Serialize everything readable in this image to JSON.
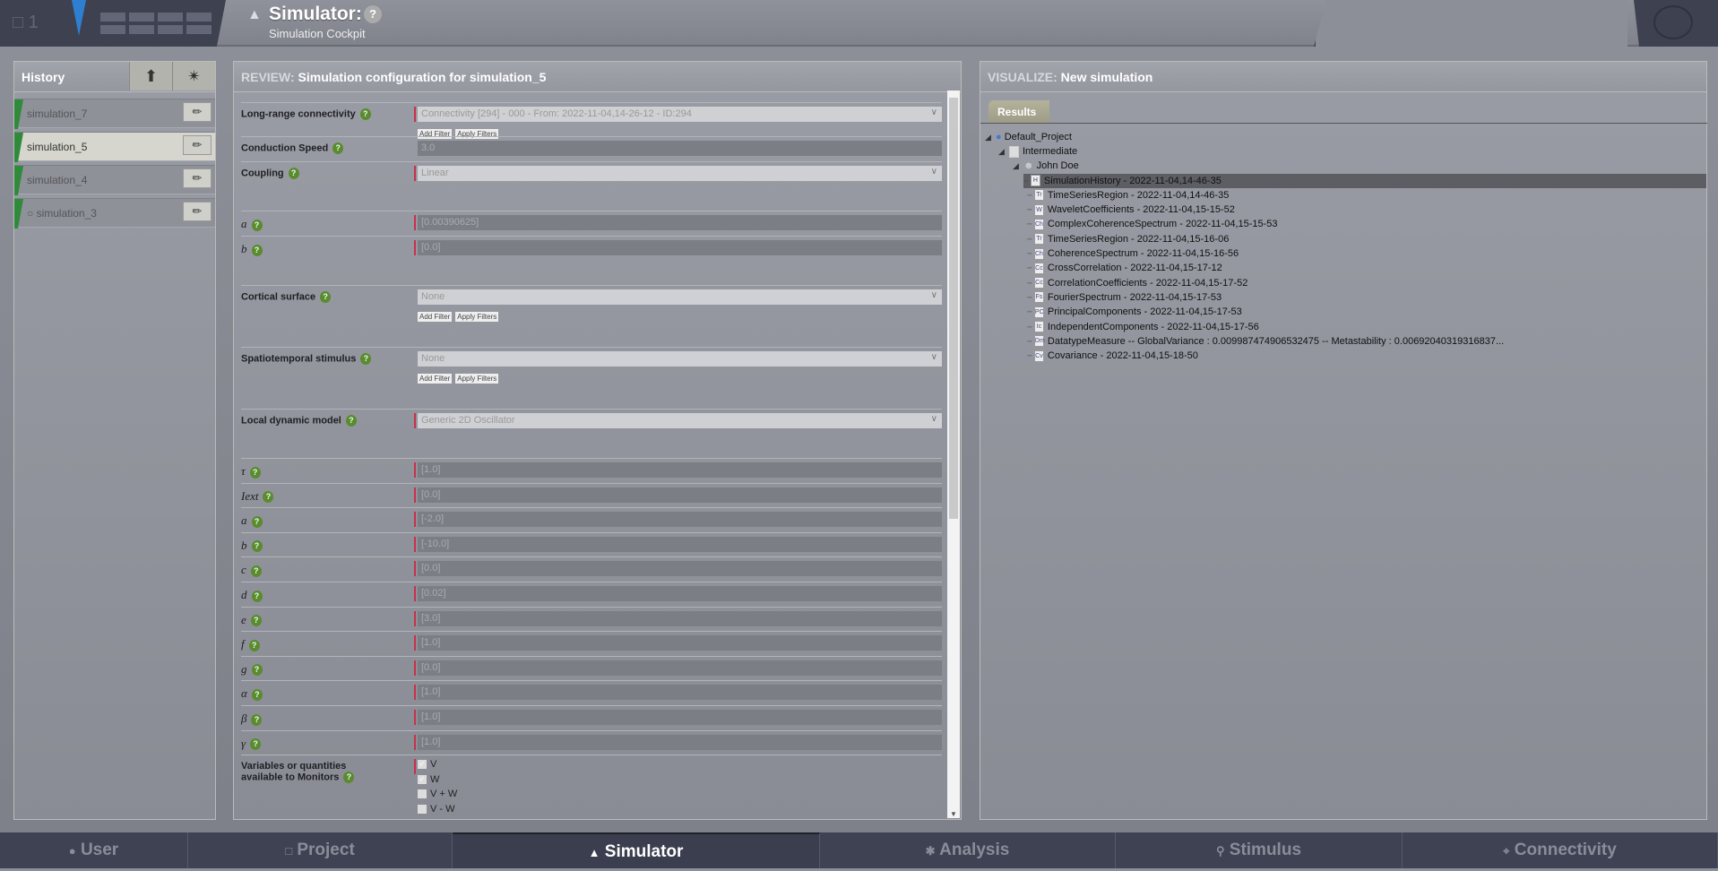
{
  "header": {
    "project_count": "1",
    "title": "Simulator:",
    "subtitle": "Simulation Cockpit",
    "help": "?"
  },
  "history": {
    "title": "History",
    "items": [
      {
        "label": "simulation_7",
        "selected": false
      },
      {
        "label": "simulation_5",
        "selected": true
      },
      {
        "label": "simulation_4",
        "selected": false
      },
      {
        "label": "○ simulation_3",
        "selected": false
      }
    ]
  },
  "review": {
    "prefix": "REVIEW:",
    "title": "Simulation configuration for simulation_5",
    "add_filter": "Add Filter",
    "apply_filters": "Apply Filters",
    "connectivity": {
      "label": "Long-range connectivity",
      "value": "Connectivity [294] - 000 - From: 2022-11-04,14-26-12 - ID:294"
    },
    "conduction": {
      "label": "Conduction Speed",
      "value": "3.0"
    },
    "coupling": {
      "label": "Coupling",
      "value": "Linear"
    },
    "coupling_params": [
      {
        "label": "a",
        "value": "[0.00390625]"
      },
      {
        "label": "b",
        "value": "[0.0]"
      }
    ],
    "cortical": {
      "label": "Cortical surface",
      "value": "None"
    },
    "stimulus": {
      "label": "Spatiotemporal stimulus",
      "value": "None"
    },
    "model": {
      "label": "Local dynamic model",
      "value": "Generic 2D Oscillator"
    },
    "model_params": [
      {
        "label": "τ",
        "value": "[1.0]"
      },
      {
        "label": "Iext",
        "value": "[0.0]"
      },
      {
        "label": "a",
        "value": "[-2.0]"
      },
      {
        "label": "b",
        "value": "[-10.0]"
      },
      {
        "label": "c",
        "value": "[0.0]"
      },
      {
        "label": "d",
        "value": "[0.02]"
      },
      {
        "label": "e",
        "value": "[3.0]"
      },
      {
        "label": "f",
        "value": "[1.0]"
      },
      {
        "label": "g",
        "value": "[0.0]"
      },
      {
        "label": "α",
        "value": "[1.0]"
      },
      {
        "label": "β",
        "value": "[1.0]"
      },
      {
        "label": "γ",
        "value": "[1.0]"
      }
    ],
    "variables": {
      "label_1": "Variables or quantities",
      "label_2": "available to Monitors",
      "options": [
        {
          "label": "V",
          "checked": true
        },
        {
          "label": "W",
          "checked": true
        },
        {
          "label": "V + W",
          "checked": false
        },
        {
          "label": "V - W",
          "checked": false
        }
      ]
    }
  },
  "visualize": {
    "prefix": "VISUALIZE:",
    "title": "New simulation",
    "tab": "Results",
    "tree": {
      "project": "Default_Project",
      "folder": "Intermediate",
      "user": "John Doe",
      "items": [
        {
          "icon": "H",
          "label": "SimulationHistory - 2022-11-04,14-46-35",
          "selected": true
        },
        {
          "icon": "Tr",
          "label": "TimeSeriesRegion - 2022-11-04,14-46-35"
        },
        {
          "icon": "W",
          "label": "WaveletCoefficients - 2022-11-04,15-15-52"
        },
        {
          "icon": "Ch",
          "label": "ComplexCoherenceSpectrum - 2022-11-04,15-15-53"
        },
        {
          "icon": "Tr",
          "label": "TimeSeriesRegion - 2022-11-04,15-16-06"
        },
        {
          "icon": "Ch",
          "label": "CoherenceSpectrum - 2022-11-04,15-16-56"
        },
        {
          "icon": "Cc",
          "label": "CrossCorrelation - 2022-11-04,15-17-12"
        },
        {
          "icon": "Cc",
          "label": "CorrelationCoefficients - 2022-11-04,15-17-52"
        },
        {
          "icon": "Fs",
          "label": "FourierSpectrum - 2022-11-04,15-17-53"
        },
        {
          "icon": "PC",
          "label": "PrincipalComponents - 2022-11-04,15-17-53"
        },
        {
          "icon": "Ic",
          "label": "IndependentComponents - 2022-11-04,15-17-56"
        },
        {
          "icon": "Dm",
          "label": "DatatypeMeasure -- GlobalVariance : 0.009987474906532475 -- Metastability : 0.00692040319316837..."
        },
        {
          "icon": "Cv",
          "label": "Covariance - 2022-11-04,15-18-50"
        }
      ]
    }
  },
  "footer": {
    "tabs": [
      {
        "label": "User",
        "icon": "user-icon"
      },
      {
        "label": "Project",
        "icon": "file-icon"
      },
      {
        "label": "Simulator",
        "icon": "rocket-icon",
        "active": true
      },
      {
        "label": "Analysis",
        "icon": "gear-icon"
      },
      {
        "label": "Stimulus",
        "icon": "pin-icon"
      },
      {
        "label": "Connectivity",
        "icon": "network-icon"
      }
    ]
  },
  "colors": {
    "header_dark": "#3d4150",
    "required_marker": "#c8304a",
    "history_green": "#2f8a3a",
    "help_green": "#5c8a2e",
    "accent_blue": "#2f7fd0"
  }
}
